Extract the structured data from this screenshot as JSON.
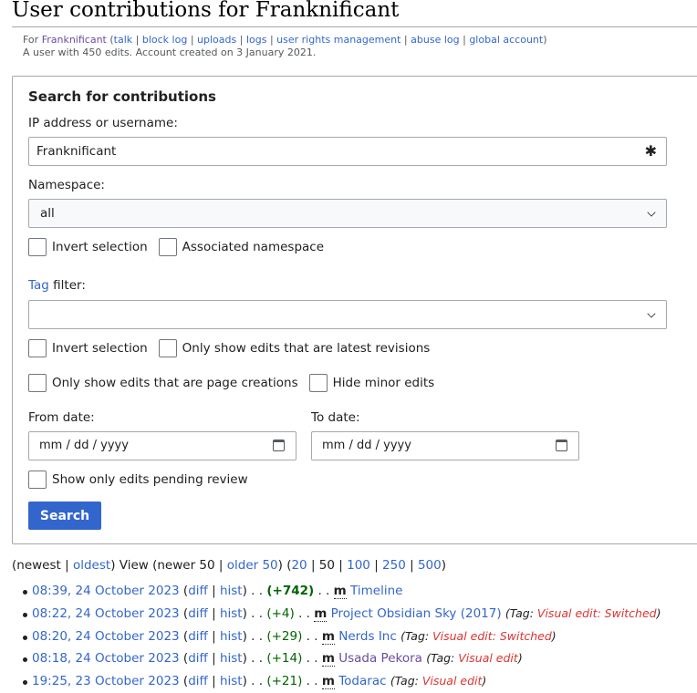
{
  "page": {
    "title": "User contributions for Franknificant"
  },
  "subtitle": {
    "for_label": "For",
    "username": "Franknificant",
    "links": [
      "talk",
      "block log",
      "uploads",
      "logs",
      "user rights management",
      "abuse log",
      "global account"
    ],
    "summary": "A user with 450 edits. Account created on 3 January 2021."
  },
  "form": {
    "legend": "Search for contributions",
    "user_label": "IP address or username:",
    "user_value": "Franknificant",
    "namespace_label": "Namespace:",
    "namespace_value": "all",
    "invert_selection_1": "Invert selection",
    "associated_namespace": "Associated namespace",
    "tag_link": "Tag",
    "tag_filter_label": " filter:",
    "tag_value": "",
    "invert_selection_2": "Invert selection",
    "latest_revisions": "Only show edits that are latest revisions",
    "page_creations": "Only show edits that are page creations",
    "hide_minor": "Hide minor edits",
    "from_date_label": "From date:",
    "from_date_placeholder": "mm / dd / yyyy",
    "to_date_label": "To date:",
    "to_date_placeholder": "mm / dd / yyyy",
    "pending_review": "Show only edits pending review",
    "search_button": "Search"
  },
  "pager": {
    "newest": "newest",
    "oldest": "oldest",
    "view": "View",
    "newer": "newer 50",
    "older": "older 50",
    "limits": [
      "20",
      "50",
      "100",
      "250",
      "500"
    ],
    "current_limit": "50"
  },
  "contributions": [
    {
      "timestamp": "08:39, 24 October 2023",
      "diff": "diff",
      "hist": "hist",
      "size": "(+742)",
      "big": true,
      "minor": "m",
      "page": "Timeline",
      "visited": false,
      "tag_label": "",
      "tag": ""
    },
    {
      "timestamp": "08:22, 24 October 2023",
      "diff": "diff",
      "hist": "hist",
      "size": "(+4)",
      "big": false,
      "minor": "m",
      "page": "Project Obsidian Sky (2017)",
      "visited": false,
      "tag_label": "Tag",
      "tag": "Visual edit: Switched"
    },
    {
      "timestamp": "08:20, 24 October 2023",
      "diff": "diff",
      "hist": "hist",
      "size": "(+29)",
      "big": false,
      "minor": "m",
      "page": "Nerds Inc",
      "visited": false,
      "tag_label": "Tag",
      "tag": "Visual edit: Switched"
    },
    {
      "timestamp": "08:18, 24 October 2023",
      "diff": "diff",
      "hist": "hist",
      "size": "(+14)",
      "big": false,
      "minor": "m",
      "page": "Usada Pekora",
      "visited": true,
      "tag_label": "Tag",
      "tag": "Visual edit"
    },
    {
      "timestamp": "19:25, 23 October 2023",
      "diff": "diff",
      "hist": "hist",
      "size": "(+21)",
      "big": false,
      "minor": "m",
      "page": "Todarac",
      "visited": false,
      "tag_label": "Tag",
      "tag": "Visual edit"
    }
  ],
  "colors": {
    "link": "#3366cc",
    "visited_link": "#6b4ba1",
    "positive_diff": "#006400",
    "tag": "#d33",
    "button": "#3366cc"
  }
}
